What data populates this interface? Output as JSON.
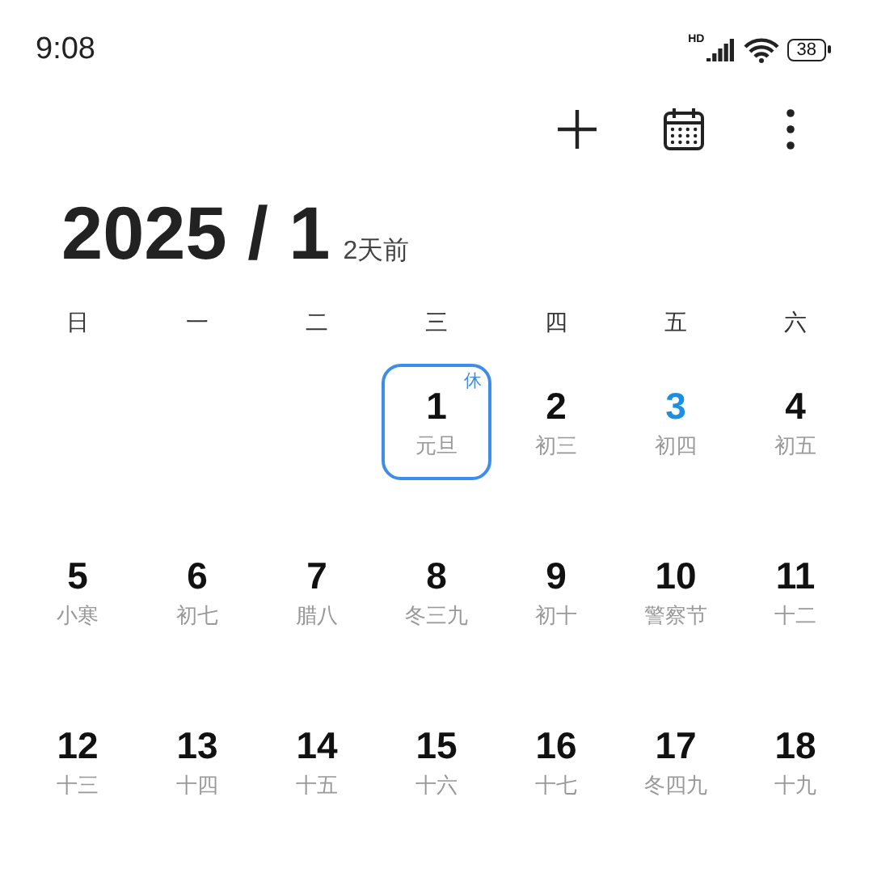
{
  "status_bar": {
    "time": "9:08",
    "network_label": "HD",
    "battery": "38"
  },
  "toolbar": {
    "actions": [
      {
        "kind": "add"
      },
      {
        "kind": "calendar"
      },
      {
        "kind": "more"
      }
    ]
  },
  "header": {
    "title": "2025 / 1",
    "relative": "2天前"
  },
  "weekdays": [
    "日",
    "一",
    "二",
    "三",
    "四",
    "五",
    "六"
  ],
  "weeks": [
    {
      "days": [
        {
          "kind": "blank"
        },
        {
          "kind": "blank"
        },
        {
          "kind": "blank"
        },
        {
          "kind": "day",
          "day": "1",
          "lunar": "元旦",
          "selected": true,
          "today": false,
          "badge": "休"
        },
        {
          "kind": "day",
          "day": "2",
          "lunar": "初三",
          "selected": false,
          "today": false
        },
        {
          "kind": "day",
          "day": "3",
          "lunar": "初四",
          "selected": false,
          "today": true
        },
        {
          "kind": "day",
          "day": "4",
          "lunar": "初五",
          "selected": false,
          "today": false
        }
      ]
    },
    {
      "days": [
        {
          "kind": "day",
          "day": "5",
          "lunar": "小寒",
          "selected": false,
          "today": false
        },
        {
          "kind": "day",
          "day": "6",
          "lunar": "初七",
          "selected": false,
          "today": false
        },
        {
          "kind": "day",
          "day": "7",
          "lunar": "腊八",
          "selected": false,
          "today": false
        },
        {
          "kind": "day",
          "day": "8",
          "lunar": "冬三九",
          "selected": false,
          "today": false
        },
        {
          "kind": "day",
          "day": "9",
          "lunar": "初十",
          "selected": false,
          "today": false
        },
        {
          "kind": "day",
          "day": "10",
          "lunar": "警察节",
          "selected": false,
          "today": false
        },
        {
          "kind": "day",
          "day": "11",
          "lunar": "十二",
          "selected": false,
          "today": false
        }
      ]
    },
    {
      "days": [
        {
          "kind": "day",
          "day": "12",
          "lunar": "十三",
          "selected": false,
          "today": false
        },
        {
          "kind": "day",
          "day": "13",
          "lunar": "十四",
          "selected": false,
          "today": false
        },
        {
          "kind": "day",
          "day": "14",
          "lunar": "十五",
          "selected": false,
          "today": false
        },
        {
          "kind": "day",
          "day": "15",
          "lunar": "十六",
          "selected": false,
          "today": false
        },
        {
          "kind": "day",
          "day": "16",
          "lunar": "十七",
          "selected": false,
          "today": false
        },
        {
          "kind": "day",
          "day": "17",
          "lunar": "冬四九",
          "selected": false,
          "today": false
        },
        {
          "kind": "day",
          "day": "18",
          "lunar": "十九",
          "selected": false,
          "today": false
        }
      ]
    }
  ]
}
